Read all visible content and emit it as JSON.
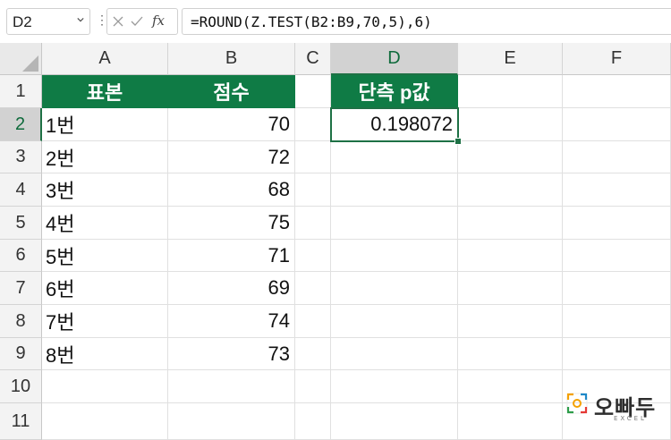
{
  "formula_bar": {
    "name_box": "D2",
    "fx_label": "fx",
    "formula": "=ROUND(Z.TEST(B2:B9,70,5),6)"
  },
  "columns": [
    "A",
    "B",
    "C",
    "D",
    "E",
    "F"
  ],
  "rows": [
    "1",
    "2",
    "3",
    "4",
    "5",
    "6",
    "7",
    "8",
    "9",
    "10",
    "11"
  ],
  "cells": {
    "A1": "표본",
    "B1": "점수",
    "D1": "단측 p값",
    "D2": "0.198072",
    "A2": "1번",
    "B2": "70",
    "A3": "2번",
    "B3": "72",
    "A4": "3번",
    "B4": "68",
    "A5": "4번",
    "B5": "75",
    "A6": "5번",
    "B6": "71",
    "A7": "6번",
    "B7": "69",
    "A8": "7번",
    "B8": "74",
    "A9": "8번",
    "B9": "73"
  },
  "selected_cell": "D2",
  "logo": {
    "text": "오빠두",
    "sub": "EXCEL"
  },
  "colors": {
    "header_fill": "#0f7b45",
    "selection": "#1e7145"
  }
}
